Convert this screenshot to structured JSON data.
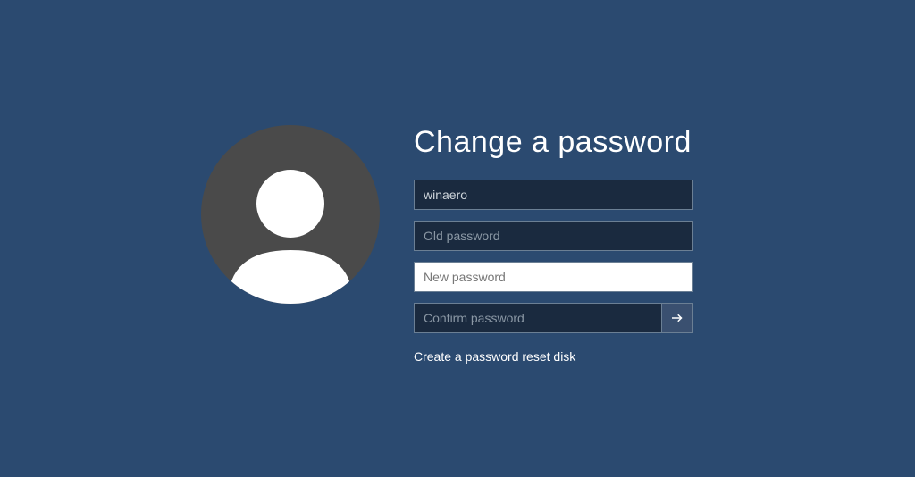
{
  "title": "Change a password",
  "username": {
    "value": "winaero"
  },
  "old_password": {
    "placeholder": "Old password",
    "value": ""
  },
  "new_password": {
    "placeholder": "New password",
    "value": ""
  },
  "confirm_password": {
    "placeholder": "Confirm password",
    "value": ""
  },
  "reset_link": "Create a password reset disk"
}
